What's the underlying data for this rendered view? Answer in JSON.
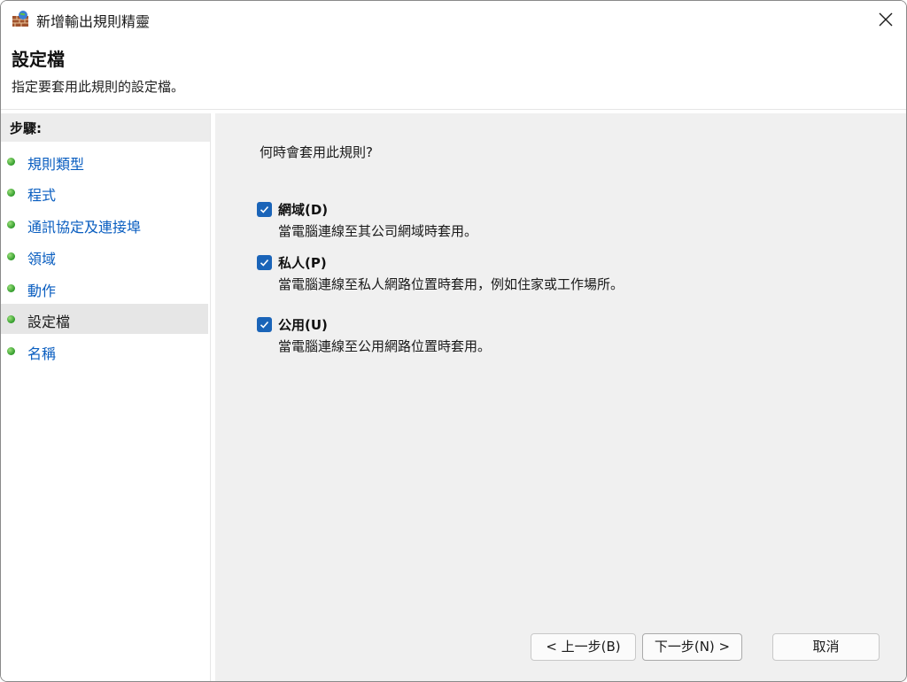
{
  "window": {
    "title": "新增輸出規則精靈"
  },
  "header": {
    "title": "設定檔",
    "subtitle": "指定要套用此規則的設定檔。"
  },
  "sidebar": {
    "heading": "步驟:",
    "items": [
      {
        "label": "規則類型",
        "active": false
      },
      {
        "label": "程式",
        "active": false
      },
      {
        "label": "通訊協定及連接埠",
        "active": false
      },
      {
        "label": "領域",
        "active": false
      },
      {
        "label": "動作",
        "active": false
      },
      {
        "label": "設定檔",
        "active": true
      },
      {
        "label": "名稱",
        "active": false
      }
    ]
  },
  "main": {
    "question": "何時會套用此規則?",
    "options": [
      {
        "label": "網域(D)",
        "description": "當電腦連線至其公司網域時套用。",
        "checked": true
      },
      {
        "label": "私人(P)",
        "description": "當電腦連線至私人網路位置時套用，例如住家或工作場所。",
        "checked": true
      },
      {
        "label": "公用(U)",
        "description": "當電腦連線至公用網路位置時套用。",
        "checked": true
      }
    ]
  },
  "buttons": {
    "back": "< 上一步(B)",
    "next": "下一步(N) >",
    "cancel": "取消"
  },
  "colors": {
    "checkbox": "#1a64b8",
    "link": "#0a5ec0",
    "content_bg": "#f0f0f0"
  }
}
